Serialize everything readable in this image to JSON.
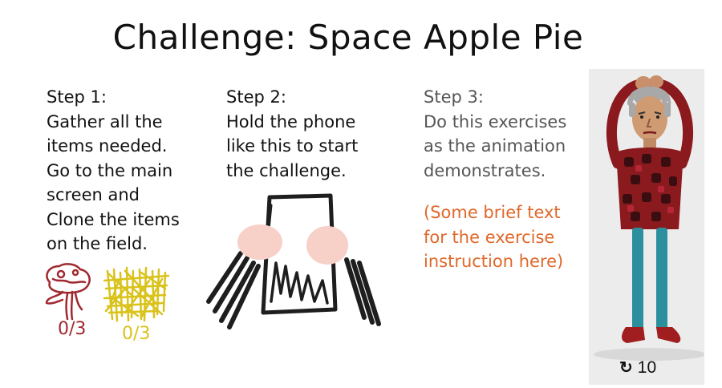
{
  "title": "Challenge: Space Apple Pie",
  "step1": {
    "heading": "Step 1:",
    "lines": [
      "Gather all the",
      "items needed.",
      "Go to the main",
      "screen and",
      "Clone the items",
      "on the field."
    ],
    "items": [
      {
        "icon": "mushroom-icon",
        "count": "0/3",
        "color": "#a0282e"
      },
      {
        "icon": "hay-icon",
        "count": "0/3",
        "color": "#d9c21a"
      }
    ]
  },
  "step2": {
    "heading": "Step 2:",
    "lines": [
      "Hold the phone",
      "like this to start",
      "the challenge."
    ]
  },
  "step3": {
    "heading": "Step 3:",
    "lines": [
      "Do this exercises",
      "as the animation",
      "demonstrates."
    ],
    "note_lines": [
      "(Some brief text",
      "for the exercise",
      "instruction here)"
    ],
    "note_color": "#e0682a"
  },
  "animation": {
    "loop_icon": "loop-icon",
    "loop_count": "10",
    "shirt_color": "#8b1a1e",
    "pants_color": "#2b8f9e",
    "shoe_color": "#a01d20"
  }
}
